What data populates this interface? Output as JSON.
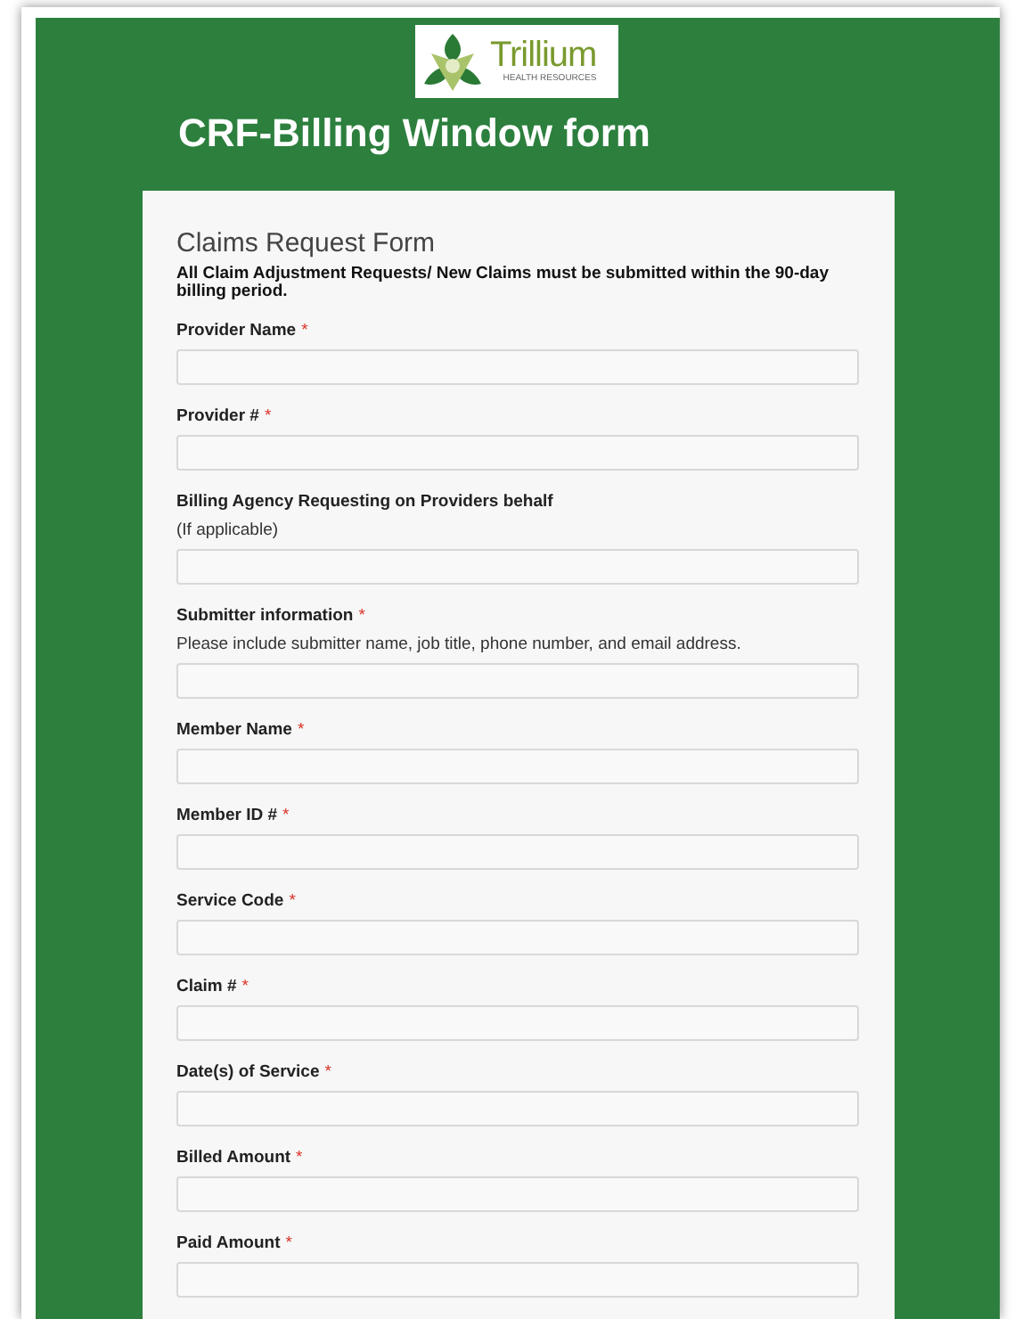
{
  "logo": {
    "name": "Trillium",
    "tagline": "HEALTH RESOURCES"
  },
  "title": "CRF-Billing Window form",
  "form": {
    "heading": "Claims Request Form",
    "notice": "All Claim Adjustment Requests/ New Claims must be submitted within the 90-day billing period.",
    "fields": [
      {
        "label": "Provider Name",
        "required_mark": "*"
      },
      {
        "label": "Provider #",
        "required_mark": "*"
      },
      {
        "label": "Billing Agency Requesting on Providers behalf",
        "hint": "(If applicable)"
      },
      {
        "label": "Submitter information",
        "required_mark": "*",
        "hint": "Please include submitter name, job title, phone number, and email address."
      },
      {
        "label": "Member Name",
        "required_mark": "*"
      },
      {
        "label": "Member ID #",
        "required_mark": "*"
      },
      {
        "label": "Service Code",
        "required_mark": "*"
      },
      {
        "label": "Claim #",
        "required_mark": "*"
      },
      {
        "label": "Date(s) of Service",
        "required_mark": "*"
      },
      {
        "label": "Billed Amount",
        "required_mark": "*"
      },
      {
        "label": "Paid Amount",
        "required_mark": "*"
      }
    ]
  }
}
